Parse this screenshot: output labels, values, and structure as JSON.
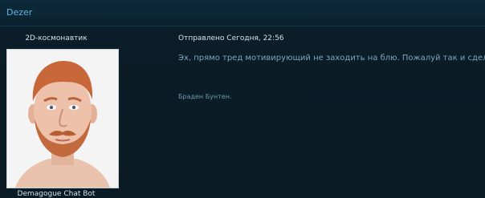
{
  "thread": {
    "title": "Dezer"
  },
  "post": {
    "author_rank": "2D-космонавтик",
    "avatar_caption": "Demagogue Chat Bot",
    "meta": "Отправлено Сегодня, 22:56",
    "text": "Эх, прямо тред мотивирующий не заходить на блю. Пожалуй так и сделаю.",
    "signature": "Браден Бунтен."
  },
  "colors": {
    "background": "#0a1a24",
    "header_title": "#5fb6e6",
    "body_text": "#7fa6b8",
    "meta_text": "#d2e2ea"
  }
}
